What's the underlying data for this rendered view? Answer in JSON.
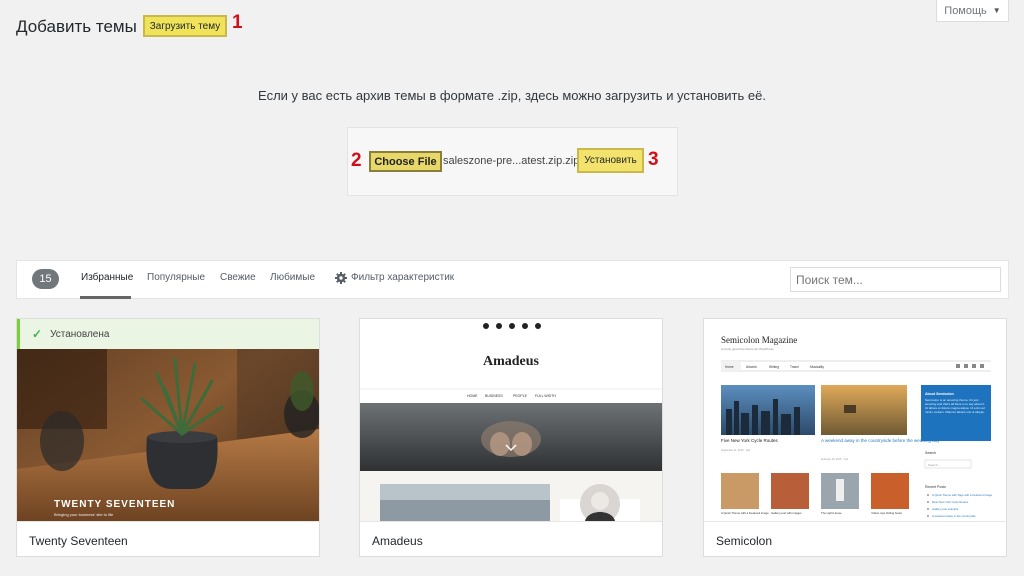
{
  "header": {
    "title": "Добавить темы",
    "upload_label": "Загрузить тему",
    "help_label": "Помощь"
  },
  "callouts": [
    "1",
    "2",
    "3"
  ],
  "upload": {
    "description": "Если у вас есть архив темы в формате .zip, здесь можно загрузить и установить её.",
    "choose_file_label": "Choose File",
    "file_name": "saleszone-pre...atest.zip.zip",
    "install_label": "Установить"
  },
  "filters": {
    "count": "15",
    "tabs": [
      "Избранные",
      "Популярные",
      "Свежие",
      "Любимые"
    ],
    "feature_filter": "Фильтр характеристик",
    "search_placeholder": "Поиск тем..."
  },
  "themes": [
    {
      "name": "Twenty Seventeen",
      "installed_label": "Установлена",
      "screenshot_title": "TWENTY SEVENTEEN",
      "screenshot_tagline": "Bringing your business' site to life"
    },
    {
      "name": "Amadeus",
      "screenshot_title": "Amadeus",
      "menu": [
        "HOME",
        "BUSINESS",
        "PEOPLE",
        "FULL WIDTH"
      ]
    },
    {
      "name": "Semicolon",
      "screenshot_title": "Semicolon Magazine",
      "screenshot_tagline": "A pretty good free theme for WordPress",
      "menu": [
        "Home",
        "Artwork",
        "Writing",
        "Travel",
        "Musicality"
      ],
      "posts": [
        "Five New York Cycle Routes",
        "A weekend away in the countryside before the wedding day"
      ],
      "post_dates": [
        "September 11, 2019 · Link",
        "February 15, 2015 · Link"
      ],
      "small_posts": [
        "A Quick Theme with a Featured Image",
        "Gallery post with images",
        "The Light House",
        "Yellow rope fishing boats"
      ],
      "sidebar_title": "About Semicolon",
      "sidebar_text": "Semicolon is an amazing theme. It's just amazing and that's all there is to say about it. Ut labore et dolore magna aliqua. Ut enim ad minim veniam. Ullamco laboris nisi ut aliquip.",
      "search_label": "Search",
      "search_placeholder": "Search ...",
      "recent_posts_label": "Recent Posts",
      "recent_posts": [
        "A Quick Theme with Tags with a Featured Image",
        "Meet New York Cycle Routes",
        "Gallery post example",
        "A weekend away in the countryside"
      ]
    }
  ],
  "colors": {
    "highlight": "#f0e35a",
    "callout_red": "#d20f18",
    "installed_green": "#46b450"
  }
}
